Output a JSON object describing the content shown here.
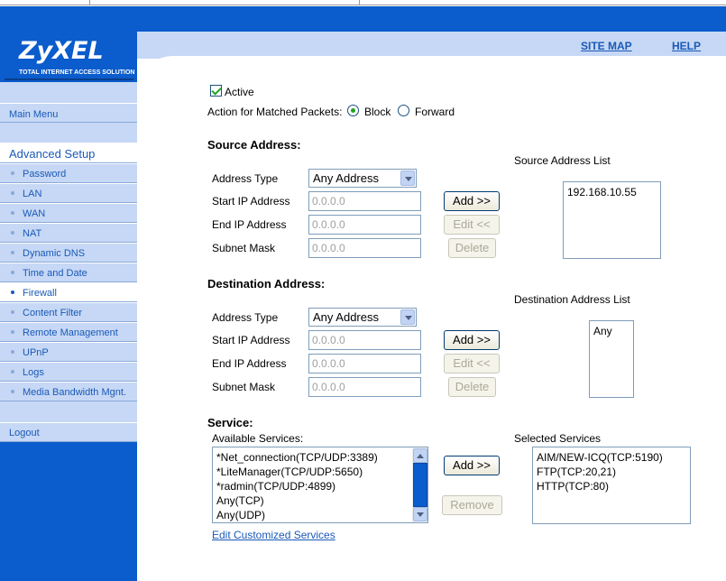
{
  "header": {
    "site_map": "SITE MAP",
    "help": "HELP"
  },
  "logo": {
    "brand": "ZyXEL",
    "tagline": "TOTAL INTERNET ACCESS SOLUTION"
  },
  "sidebar": {
    "main_menu": "Main Menu",
    "advanced_setup": "Advanced Setup",
    "items": [
      {
        "label": "Password"
      },
      {
        "label": "LAN"
      },
      {
        "label": "WAN"
      },
      {
        "label": "NAT"
      },
      {
        "label": "Dynamic DNS"
      },
      {
        "label": "Time and Date"
      },
      {
        "label": "Firewall",
        "active": true
      },
      {
        "label": "Content Filter"
      },
      {
        "label": "Remote Management"
      },
      {
        "label": "UPnP"
      },
      {
        "label": "Logs"
      },
      {
        "label": "Media Bandwidth Mgnt."
      }
    ],
    "logout": "Logout"
  },
  "form": {
    "active_label": "Active",
    "action_label": "Action for Matched Packets:",
    "block_label": "Block",
    "forward_label": "Forward",
    "action_selected": "Block",
    "source": {
      "title": "Source Address:",
      "address_type_label": "Address Type",
      "address_type_value": "Any Address",
      "start_ip_label": "Start IP Address",
      "start_ip_value": "0.0.0.0",
      "end_ip_label": "End IP Address",
      "end_ip_value": "0.0.0.0",
      "subnet_label": "Subnet Mask",
      "subnet_value": "0.0.0.0",
      "add_button": "Add >>",
      "edit_button": "Edit <<",
      "delete_button": "Delete",
      "list_title": "Source Address List",
      "list_items": [
        "192.168.10.55"
      ]
    },
    "destination": {
      "title": "Destination Address:",
      "address_type_label": "Address Type",
      "address_type_value": "Any Address",
      "start_ip_label": "Start IP Address",
      "start_ip_value": "0.0.0.0",
      "end_ip_label": "End IP Address",
      "end_ip_value": "0.0.0.0",
      "subnet_label": "Subnet Mask",
      "subnet_value": "0.0.0.0",
      "add_button": "Add >>",
      "edit_button": "Edit <<",
      "delete_button": "Delete",
      "list_title": "Destination Address List",
      "list_items": [
        "Any"
      ]
    },
    "service": {
      "title": "Service:",
      "available_label": "Available Services:",
      "available_items": [
        "*Net_connection(TCP/UDP:3389)",
        "*LiteManager(TCP/UDP:5650)",
        "*radmin(TCP/UDP:4899)",
        "Any(TCP)",
        "Any(UDP)"
      ],
      "add_button": "Add >>",
      "remove_button": "Remove",
      "selected_label": "Selected Services",
      "selected_items": [
        "AIM/NEW-ICQ(TCP:5190)",
        "FTP(TCP:20,21)",
        "HTTP(TCP:80)"
      ],
      "edit_link": "Edit Customized Services"
    }
  }
}
